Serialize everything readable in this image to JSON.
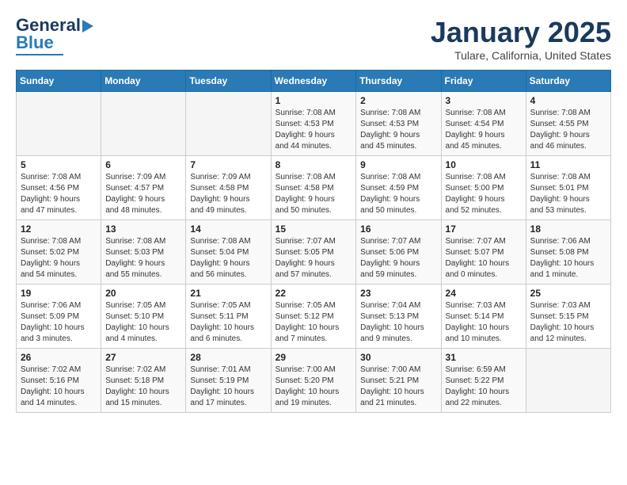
{
  "header": {
    "logo_line1": "General",
    "logo_line2": "Blue",
    "month": "January 2025",
    "location": "Tulare, California, United States"
  },
  "weekdays": [
    "Sunday",
    "Monday",
    "Tuesday",
    "Wednesday",
    "Thursday",
    "Friday",
    "Saturday"
  ],
  "weeks": [
    [
      {
        "day": "",
        "info": ""
      },
      {
        "day": "",
        "info": ""
      },
      {
        "day": "",
        "info": ""
      },
      {
        "day": "1",
        "info": "Sunrise: 7:08 AM\nSunset: 4:53 PM\nDaylight: 9 hours\nand 44 minutes."
      },
      {
        "day": "2",
        "info": "Sunrise: 7:08 AM\nSunset: 4:53 PM\nDaylight: 9 hours\nand 45 minutes."
      },
      {
        "day": "3",
        "info": "Sunrise: 7:08 AM\nSunset: 4:54 PM\nDaylight: 9 hours\nand 45 minutes."
      },
      {
        "day": "4",
        "info": "Sunrise: 7:08 AM\nSunset: 4:55 PM\nDaylight: 9 hours\nand 46 minutes."
      }
    ],
    [
      {
        "day": "5",
        "info": "Sunrise: 7:08 AM\nSunset: 4:56 PM\nDaylight: 9 hours\nand 47 minutes."
      },
      {
        "day": "6",
        "info": "Sunrise: 7:09 AM\nSunset: 4:57 PM\nDaylight: 9 hours\nand 48 minutes."
      },
      {
        "day": "7",
        "info": "Sunrise: 7:09 AM\nSunset: 4:58 PM\nDaylight: 9 hours\nand 49 minutes."
      },
      {
        "day": "8",
        "info": "Sunrise: 7:08 AM\nSunset: 4:58 PM\nDaylight: 9 hours\nand 50 minutes."
      },
      {
        "day": "9",
        "info": "Sunrise: 7:08 AM\nSunset: 4:59 PM\nDaylight: 9 hours\nand 50 minutes."
      },
      {
        "day": "10",
        "info": "Sunrise: 7:08 AM\nSunset: 5:00 PM\nDaylight: 9 hours\nand 52 minutes."
      },
      {
        "day": "11",
        "info": "Sunrise: 7:08 AM\nSunset: 5:01 PM\nDaylight: 9 hours\nand 53 minutes."
      }
    ],
    [
      {
        "day": "12",
        "info": "Sunrise: 7:08 AM\nSunset: 5:02 PM\nDaylight: 9 hours\nand 54 minutes."
      },
      {
        "day": "13",
        "info": "Sunrise: 7:08 AM\nSunset: 5:03 PM\nDaylight: 9 hours\nand 55 minutes."
      },
      {
        "day": "14",
        "info": "Sunrise: 7:08 AM\nSunset: 5:04 PM\nDaylight: 9 hours\nand 56 minutes."
      },
      {
        "day": "15",
        "info": "Sunrise: 7:07 AM\nSunset: 5:05 PM\nDaylight: 9 hours\nand 57 minutes."
      },
      {
        "day": "16",
        "info": "Sunrise: 7:07 AM\nSunset: 5:06 PM\nDaylight: 9 hours\nand 59 minutes."
      },
      {
        "day": "17",
        "info": "Sunrise: 7:07 AM\nSunset: 5:07 PM\nDaylight: 10 hours\nand 0 minutes."
      },
      {
        "day": "18",
        "info": "Sunrise: 7:06 AM\nSunset: 5:08 PM\nDaylight: 10 hours\nand 1 minute."
      }
    ],
    [
      {
        "day": "19",
        "info": "Sunrise: 7:06 AM\nSunset: 5:09 PM\nDaylight: 10 hours\nand 3 minutes."
      },
      {
        "day": "20",
        "info": "Sunrise: 7:05 AM\nSunset: 5:10 PM\nDaylight: 10 hours\nand 4 minutes."
      },
      {
        "day": "21",
        "info": "Sunrise: 7:05 AM\nSunset: 5:11 PM\nDaylight: 10 hours\nand 6 minutes."
      },
      {
        "day": "22",
        "info": "Sunrise: 7:05 AM\nSunset: 5:12 PM\nDaylight: 10 hours\nand 7 minutes."
      },
      {
        "day": "23",
        "info": "Sunrise: 7:04 AM\nSunset: 5:13 PM\nDaylight: 10 hours\nand 9 minutes."
      },
      {
        "day": "24",
        "info": "Sunrise: 7:03 AM\nSunset: 5:14 PM\nDaylight: 10 hours\nand 10 minutes."
      },
      {
        "day": "25",
        "info": "Sunrise: 7:03 AM\nSunset: 5:15 PM\nDaylight: 10 hours\nand 12 minutes."
      }
    ],
    [
      {
        "day": "26",
        "info": "Sunrise: 7:02 AM\nSunset: 5:16 PM\nDaylight: 10 hours\nand 14 minutes."
      },
      {
        "day": "27",
        "info": "Sunrise: 7:02 AM\nSunset: 5:18 PM\nDaylight: 10 hours\nand 15 minutes."
      },
      {
        "day": "28",
        "info": "Sunrise: 7:01 AM\nSunset: 5:19 PM\nDaylight: 10 hours\nand 17 minutes."
      },
      {
        "day": "29",
        "info": "Sunrise: 7:00 AM\nSunset: 5:20 PM\nDaylight: 10 hours\nand 19 minutes."
      },
      {
        "day": "30",
        "info": "Sunrise: 7:00 AM\nSunset: 5:21 PM\nDaylight: 10 hours\nand 21 minutes."
      },
      {
        "day": "31",
        "info": "Sunrise: 6:59 AM\nSunset: 5:22 PM\nDaylight: 10 hours\nand 22 minutes."
      },
      {
        "day": "",
        "info": ""
      }
    ]
  ]
}
